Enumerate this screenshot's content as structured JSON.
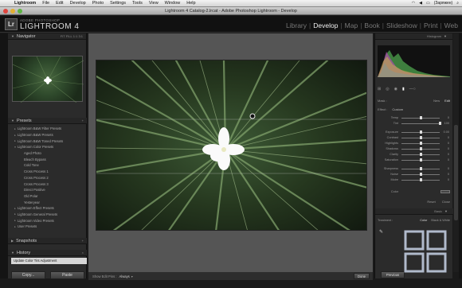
{
  "menubar": {
    "apple": "",
    "items": [
      "Lightroom",
      "File",
      "Edit",
      "Develop",
      "Photo",
      "Settings",
      "Tools",
      "View",
      "Window",
      "Help"
    ],
    "status": "(Заряжен)"
  },
  "window": {
    "title": "Lightroom 4 Catalog-2.lrcat - Adobe Photoshop Lightroom - Develop"
  },
  "identity": {
    "logo": "Lr",
    "brand_small": "ADOBE PHOTOSHOP",
    "brand_large": "LIGHTROOM 4",
    "modules": [
      "Library",
      "Develop",
      "Map",
      "Book",
      "Slideshow",
      "Print",
      "Web"
    ],
    "active_module": "Develop"
  },
  "left_panel": {
    "navigator": {
      "title": "Navigator",
      "zoom_options": [
        "FIT",
        "FILL",
        "1:1",
        "3:1"
      ]
    },
    "presets": {
      "title": "Presets",
      "items": [
        {
          "label": "Lightroom B&W Filter Presets",
          "toggle": "▸"
        },
        {
          "label": "Lightroom B&W Presets",
          "toggle": "▸"
        },
        {
          "label": "Lightroom B&W Toned Presets",
          "toggle": "▸"
        },
        {
          "label": "Lightroom Color Presets",
          "toggle": "▾"
        },
        {
          "label": "Aged Photo",
          "toggle": ""
        },
        {
          "label": "Bleach Bypass",
          "toggle": ""
        },
        {
          "label": "Cold Tone",
          "toggle": ""
        },
        {
          "label": "Cross Process 1",
          "toggle": ""
        },
        {
          "label": "Cross Process 2",
          "toggle": ""
        },
        {
          "label": "Cross Process 3",
          "toggle": ""
        },
        {
          "label": "Direct Positive",
          "toggle": ""
        },
        {
          "label": "Old Polar",
          "toggle": ""
        },
        {
          "label": "Yesteryear",
          "toggle": ""
        },
        {
          "label": "Lightroom Effect Presets",
          "toggle": "▸"
        },
        {
          "label": "Lightroom General Presets",
          "toggle": "▸"
        },
        {
          "label": "Lightroom Video Presets",
          "toggle": "▸"
        },
        {
          "label": "User Presets",
          "toggle": "▸"
        }
      ]
    },
    "snapshots": {
      "title": "Snapshots"
    },
    "history": {
      "title": "History",
      "current": "Update Color Tint Adjustment"
    },
    "copy_label": "Copy...",
    "paste_label": "Paste"
  },
  "toolbar": {
    "show_edit_pins": "Show Edit Pins :",
    "edit_pins_value": "Always",
    "done_label": "Done"
  },
  "right_panel": {
    "histogram": {
      "title": "Histogram"
    },
    "mask_row": {
      "mask_label": "Mask :",
      "new_label": "New",
      "edit_label": "Edit"
    },
    "effect": {
      "label": "Effect :",
      "value": "Custom"
    },
    "sliders": [
      {
        "label": "Temp",
        "value": "0",
        "pos": 0.5
      },
      {
        "label": "Tint",
        "value": "100",
        "pos": 1.0
      },
      {
        "label": "Exposure",
        "value": "0.00",
        "pos": 0.5
      },
      {
        "label": "Contrast",
        "value": "0",
        "pos": 0.5
      },
      {
        "label": "Highlights",
        "value": "0",
        "pos": 0.5
      },
      {
        "label": "Shadows",
        "value": "0",
        "pos": 0.5
      },
      {
        "label": "Clarity",
        "value": "0",
        "pos": 0.5
      },
      {
        "label": "Saturation",
        "value": "0",
        "pos": 0.5
      },
      {
        "label": "Sharpness",
        "value": "0",
        "pos": 0.5
      },
      {
        "label": "Noise",
        "value": "0",
        "pos": 0.5
      },
      {
        "label": "Moire",
        "value": "0",
        "pos": 0.5
      }
    ],
    "color_label": "Color",
    "reset_label": "Reset",
    "close_label": "Close",
    "basic": {
      "title": "Basic",
      "treatment_label": "Treatment :",
      "color_label": "Color",
      "bw_label": "Black & White"
    },
    "prev_label": "Previous"
  }
}
